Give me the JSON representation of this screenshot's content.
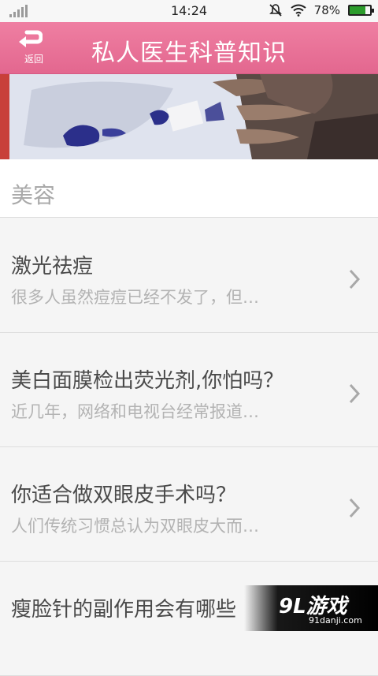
{
  "status_bar": {
    "time": "14:24",
    "battery": "78%",
    "battery_level": 0.78
  },
  "header": {
    "back_label": "返回",
    "title": "私人医生科普知识"
  },
  "section": {
    "title": "美容"
  },
  "articles": [
    {
      "title": "激光祛痘",
      "summary": "很多人虽然痘痘已经不发了，但…"
    },
    {
      "title": "美白面膜检出荧光剂,你怕吗？",
      "summary": "近几年，网络和电视台经常报道…"
    },
    {
      "title": "你适合做双眼皮手术吗？",
      "summary": "人们传统习惯总认为双眼皮大而…"
    },
    {
      "title": "瘦脸针的副作用会有哪些",
      "summary": ""
    }
  ],
  "watermark": {
    "brand": "9L游戏",
    "url": "91danji.com"
  },
  "colors": {
    "header": "#e87499",
    "title_text": "#4a4a4a",
    "summary_text": "#b3b3b3"
  }
}
